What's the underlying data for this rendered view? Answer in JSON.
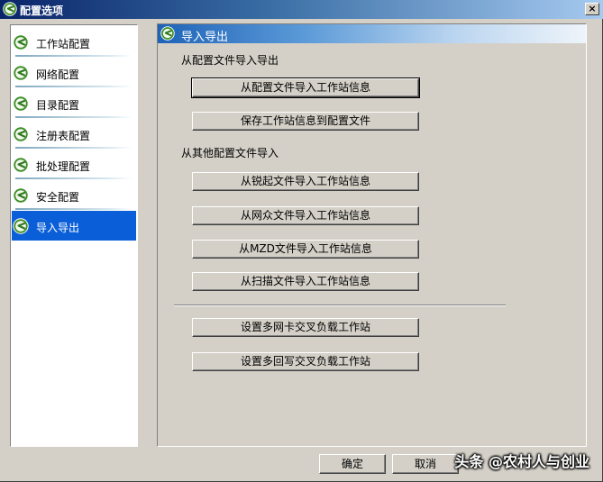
{
  "window": {
    "title": "配置选项",
    "close_glyph": "×"
  },
  "sidebar": {
    "items": [
      {
        "label": "工作站配置",
        "icon": "app-logo-icon",
        "selected": false
      },
      {
        "label": "网络配置",
        "icon": "app-logo-icon",
        "selected": false
      },
      {
        "label": "目录配置",
        "icon": "app-logo-icon",
        "selected": false
      },
      {
        "label": "注册表配置",
        "icon": "app-logo-icon",
        "selected": false
      },
      {
        "label": "批处理配置",
        "icon": "app-logo-icon",
        "selected": false
      },
      {
        "label": "安全配置",
        "icon": "app-logo-icon",
        "selected": false
      },
      {
        "label": "导入导出",
        "icon": "app-logo-icon",
        "selected": true
      }
    ]
  },
  "panel": {
    "header": "导入导出",
    "section1_label": "从配置文件导入导出",
    "section2_label": "从其他配置文件导入",
    "buttons": [
      "从配置文件导入工作站信息",
      "保存工作站信息到配置文件",
      "从锐起文件导入工作站信息",
      "从网众文件导入工作站信息",
      "从MZD文件导入工作站信息",
      "从扫描文件导入工作站信息",
      "设置多网卡交叉负载工作站",
      "设置多回写交叉负载工作站"
    ]
  },
  "footer": {
    "ok_label": "确定",
    "cancel_label": "取消"
  },
  "watermark": "头条 @农村人与创业",
  "colors": {
    "title_bar_start": "#0a246a",
    "selected_item": "#0a5fd8",
    "panel_header": "#1e63b8",
    "window_bg": "#d4d0c8"
  }
}
